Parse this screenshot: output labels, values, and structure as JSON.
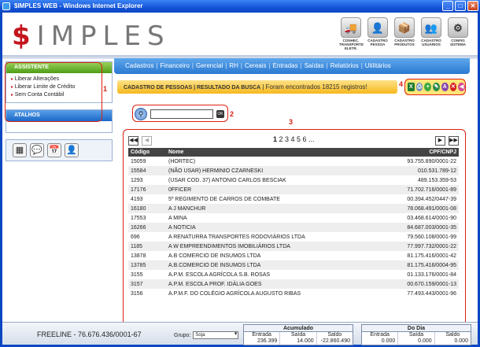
{
  "window": {
    "title": "$IMPLES WEB - Windows Internet Explorer",
    "minimize": "_",
    "maximize": "□",
    "close": "✕"
  },
  "logo": {
    "dollar": "$",
    "rest": "IMPLES"
  },
  "top_icons": [
    {
      "label": "CONHEC. TRANSPORTE ELETR.",
      "icon": "truck-icon",
      "glyph": "🚚"
    },
    {
      "label": "CADASTRO PESSOA",
      "icon": "person-icon",
      "glyph": "👤"
    },
    {
      "label": "CADASTRO PRODUTOS",
      "icon": "box-icon",
      "glyph": "📦"
    },
    {
      "label": "CADASTRO USUÁRIOS",
      "icon": "user-icon",
      "glyph": "👥"
    },
    {
      "label": "CONFIG SISTEMA",
      "icon": "gear-icon",
      "glyph": "⚙"
    }
  ],
  "sidebar": {
    "assistente_title": "ASSISTENTE",
    "assistente_items": [
      "Liberar Alterações",
      "Liberar Limite de Crédito",
      "Sem Conta Contábil"
    ],
    "atalhos_title": "ATALHOS",
    "shortcuts": [
      {
        "icon": "calculator-icon",
        "glyph": "▦"
      },
      {
        "icon": "chat-icon",
        "glyph": "💬"
      },
      {
        "icon": "calendar-icon",
        "glyph": "📅"
      },
      {
        "icon": "user-icon",
        "glyph": "👤"
      }
    ]
  },
  "markers": {
    "m1": "1",
    "m2": "2",
    "m3": "3",
    "m4": "4"
  },
  "nav": {
    "items": [
      "Cadastros",
      "Financeiro",
      "Gerencial",
      "RH",
      "Cereais",
      "Entradas",
      "Saídas",
      "Relatórios",
      "Utilitários"
    ],
    "separator": "|"
  },
  "header_strip": {
    "title": "CADASTRO DE PESSOAS | RESULTADO DA BUSCA",
    "sep": " | ",
    "message": "Foram encontrados 18215 registros!"
  },
  "actions": [
    {
      "icon": "excel-icon",
      "glyph": "X",
      "color": "#1e7b2e"
    },
    {
      "icon": "printer-icon",
      "glyph": "⎙",
      "color": "#6c8fb8"
    },
    {
      "icon": "add-icon",
      "glyph": "+",
      "color": "#3ba83a"
    },
    {
      "icon": "edit-icon",
      "glyph": "✎",
      "color": "#2d8c4a"
    },
    {
      "icon": "search-icon",
      "glyph": "A",
      "color": "#8844aa"
    },
    {
      "icon": "delete-icon",
      "glyph": "✕",
      "color": "#d42020"
    },
    {
      "icon": "back-icon",
      "glyph": "◀",
      "color": "#d44a90"
    }
  ],
  "search": {
    "value": "",
    "placeholder": "",
    "ok_label": "OK"
  },
  "pager": {
    "current": "1",
    "others": "2 3 4 5 6 ...",
    "first": "◀◀",
    "prev": "◀",
    "next": "▶",
    "last": "▶▶"
  },
  "table": {
    "headers": {
      "code": "Código",
      "name": "Nome",
      "doc": "CPF/CNPJ"
    },
    "rows": [
      [
        "15059",
        "(HORTEC)",
        "93.755.890/0001-22"
      ],
      [
        "15584",
        "(NÃO USAR) HERMINIO CZARNESKI",
        "010.531.789-12"
      ],
      [
        "1293",
        "(USAR COD. 37) ANTONIO CARLOS BESCIAK",
        "489.153.359-53"
      ],
      [
        "17176",
        "0FFICER",
        "71.702.716/0001-89"
      ],
      [
        "4193",
        "5º REGIMENTO DE CARROS DE COMBATE",
        "00.394.452/0447-39"
      ],
      [
        "16180",
        "A J MANCHUR",
        "78.068.491/0001-08"
      ],
      [
        "17553",
        "A MINA",
        "03.468.614/0001-90"
      ],
      [
        "16266",
        "A NOTICIA",
        "84.687.003/0001-35"
      ],
      [
        "696",
        "A RENATURRA TRANSPORTES RODOVIÁRIOS LTDA",
        "79.560.108/0001-99"
      ],
      [
        "1185",
        "A W EMPREENDIMENTOS IMOBILIÁRIOS LTDA",
        "77.997.732/0001-22"
      ],
      [
        "13878",
        "A.B COMERCIO DE INSUMOS LTDA",
        "81.175.416/0001-42"
      ],
      [
        "13785",
        "A.B.COMERCIO DE INSUMOS LTDA",
        "81.175.416/0004-95"
      ],
      [
        "3155",
        "A.P.M. ESCOLA AGRÍCOLA S.B. ROSAS",
        "01.133.176/0001-84"
      ],
      [
        "3157",
        "A.P.M. ESCOLA PROF. IDÁLIA GOES",
        "00.670.159/0001-13"
      ],
      [
        "3156",
        "A.P.M.F. DO COLÉGIO AGRÍCOLA AUGUSTO RIBAS",
        "77.493.443/0001-96"
      ]
    ]
  },
  "footer": {
    "freeline": "FREELINE - 76.676.436/0001-67",
    "grupo_label": "Grupo:",
    "grupo_value": "Soja",
    "acumulado": {
      "title": "Acumulado",
      "cols": [
        "Entrada",
        "Saída",
        "Saldo"
      ],
      "vals": [
        "236.399",
        "14.000",
        "-22.860.490"
      ]
    },
    "dodia": {
      "title": "Do Dia",
      "cols": [
        "Entrada",
        "Saída",
        "Saldo"
      ],
      "vals": [
        "0.000",
        "0.000",
        "0.000"
      ]
    }
  }
}
